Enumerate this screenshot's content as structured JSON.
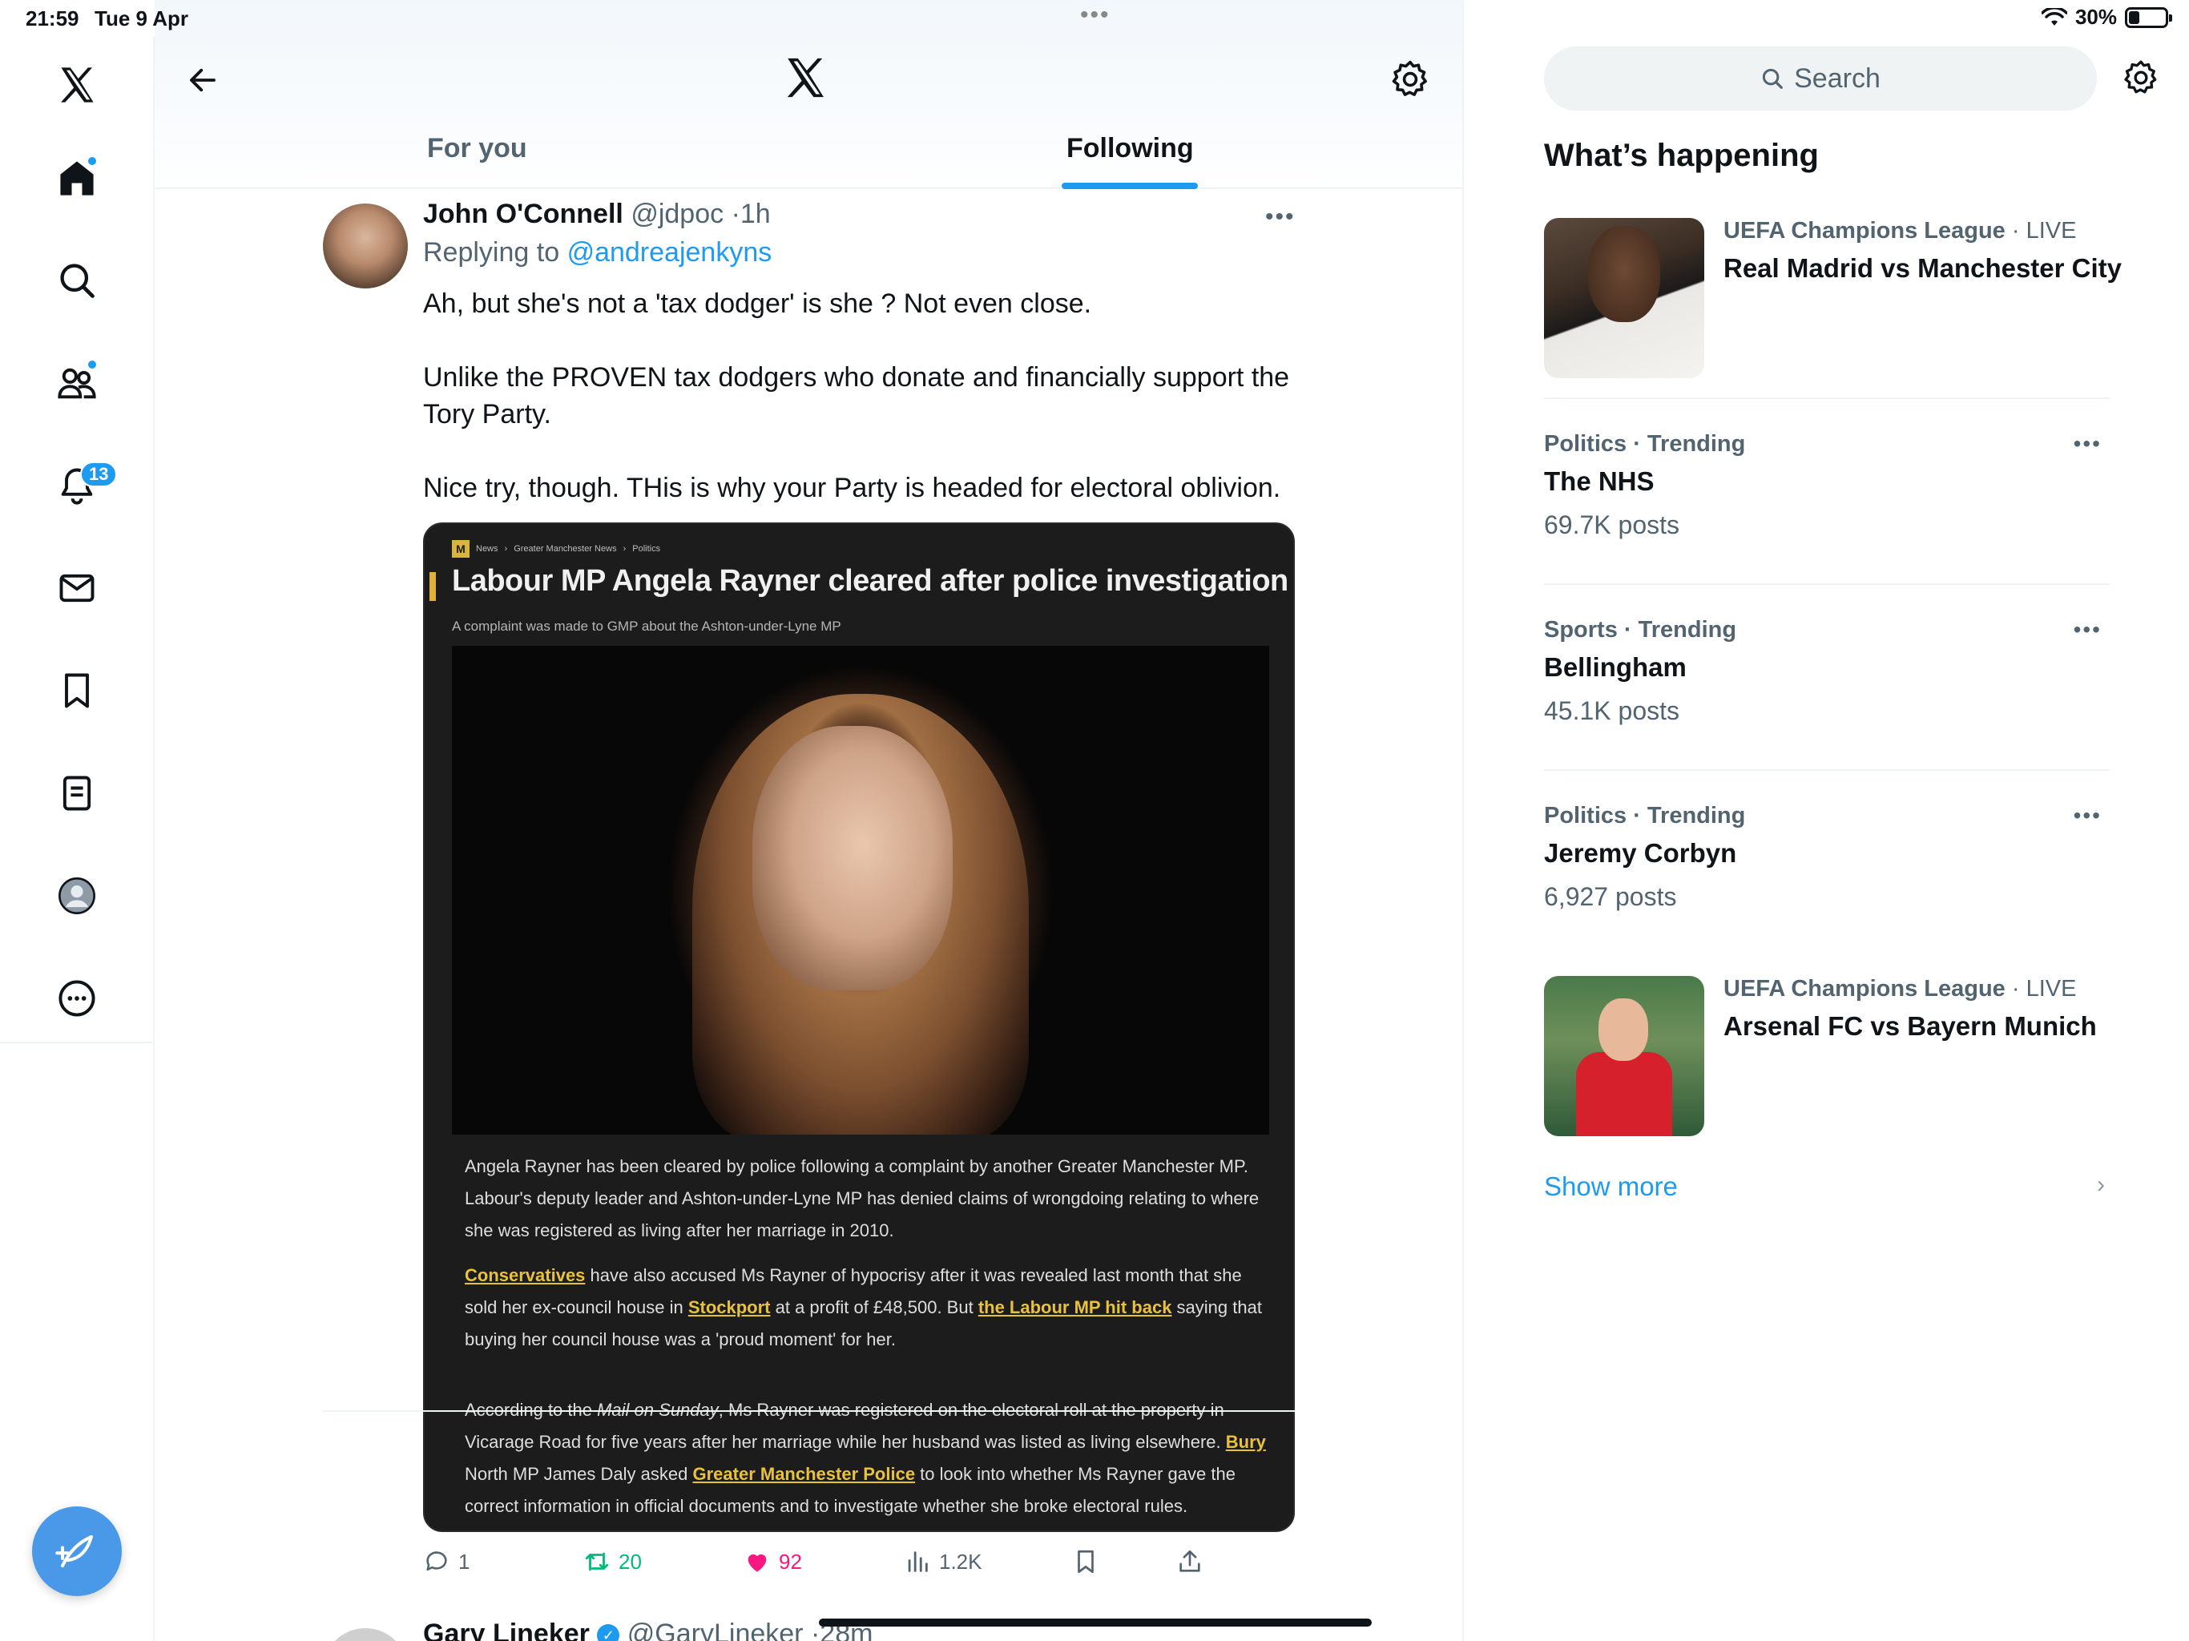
{
  "status_bar": {
    "time": "21:59",
    "date": "Tue 9 Apr",
    "battery": "30%",
    "battery_level": 0.3,
    "center_dots": "•••"
  },
  "left_nav": {
    "items": [
      {
        "name": "x-logo-icon"
      },
      {
        "name": "home-icon"
      },
      {
        "name": "search-icon"
      },
      {
        "name": "communities-icon"
      },
      {
        "name": "notifications-icon",
        "badge": "13"
      },
      {
        "name": "messages-icon"
      },
      {
        "name": "bookmarks-icon"
      },
      {
        "name": "lists-icon"
      },
      {
        "name": "profile-icon"
      },
      {
        "name": "more-icon"
      }
    ],
    "compose_icon": "compose-feather-icon"
  },
  "header": {
    "tabs": [
      {
        "label": "For you",
        "active": false
      },
      {
        "label": "Following",
        "active": true
      }
    ]
  },
  "tweet": {
    "name": "John O'Connell",
    "handle": "@jdpoc",
    "separator": "·",
    "time": "1h",
    "more": "•••",
    "replying_prefix": "Replying to",
    "replying_to": "@andreajenkyns",
    "paragraphs": [
      "Ah, but she's not a 'tax dodger' is she ? Not even close.",
      "Unlike the PROVEN tax dodgers who donate and financially support the Tory Party.",
      "Nice try, though. THis is why your Party is headed for electoral oblivion."
    ],
    "card": {
      "logo": "M",
      "breadcrumbs": [
        "News",
        "Greater Manchester News",
        "Politics"
      ],
      "crumb_sep": "›",
      "headline": "Labour MP Angela Rayner cleared after police investigation",
      "subhead": "A complaint was made to GMP about the Ashton-under-Lyne MP",
      "p1": "Angela Rayner has been cleared by police following a complaint by another Greater Manchester MP. Labour's deputy leader and Ashton-under-Lyne MP has denied claims of wrongdoing relating to where she was registered as living after her marriage in 2010.",
      "p2": {
        "link1": "Conservatives",
        "t1": " have also accused Ms Rayner of hypocrisy after it was revealed last month that she sold her ex-council house in ",
        "link2": "Stockport",
        "t2": " at a profit of £48,500. But ",
        "link3": "the Labour MP hit back",
        "t3": " saying that buying her council house was a 'proud moment' for her."
      },
      "p3": {
        "t1": "According to the ",
        "em": "Mail on Sunday",
        "t2": ", Ms Rayner was registered on the electoral roll at the property in Vicarage Road for five years after her marriage while her husband was listed as living elsewhere. ",
        "link1": "Bury",
        "t3": " North MP James Daly asked ",
        "link2": "Greater Manchester Police",
        "t4": " to look into whether Ms Rayner gave the correct information in official documents and to investigate whether she broke electoral rules."
      }
    },
    "actions": {
      "replies": "1",
      "retweets": "20",
      "likes": "92",
      "views": "1.2K"
    }
  },
  "next_tweet": {
    "name": "Gary Lineker",
    "handle": "@GaryLineker",
    "time": "28m"
  },
  "right": {
    "search_placeholder": "Search",
    "section_title": "What’s happening",
    "trends": [
      {
        "meta": "UEFA Champions League",
        "live": " · LIVE",
        "title": "Real Madrid vs Manchester City"
      },
      {
        "meta": "Politics · Trending",
        "title": "The NHS",
        "count": "69.7K posts"
      },
      {
        "meta": "Sports · Trending",
        "title": "Bellingham",
        "count": "45.1K posts"
      },
      {
        "meta": "Politics · Trending",
        "title": "Jeremy Corbyn",
        "count": "6,927 posts"
      },
      {
        "meta": "UEFA Champions League",
        "live": " · LIVE",
        "title": "Arsenal FC vs Bayern Munich"
      }
    ],
    "more_dots": "•••",
    "show_more": "Show more",
    "chevron": "›"
  },
  "colors": {
    "accent": "#1d9bf0",
    "retweet": "#00ba7c",
    "like": "#f91880",
    "muted": "#536471",
    "card_bg": "#1c1c1c",
    "card_link": "#e8c23c"
  }
}
